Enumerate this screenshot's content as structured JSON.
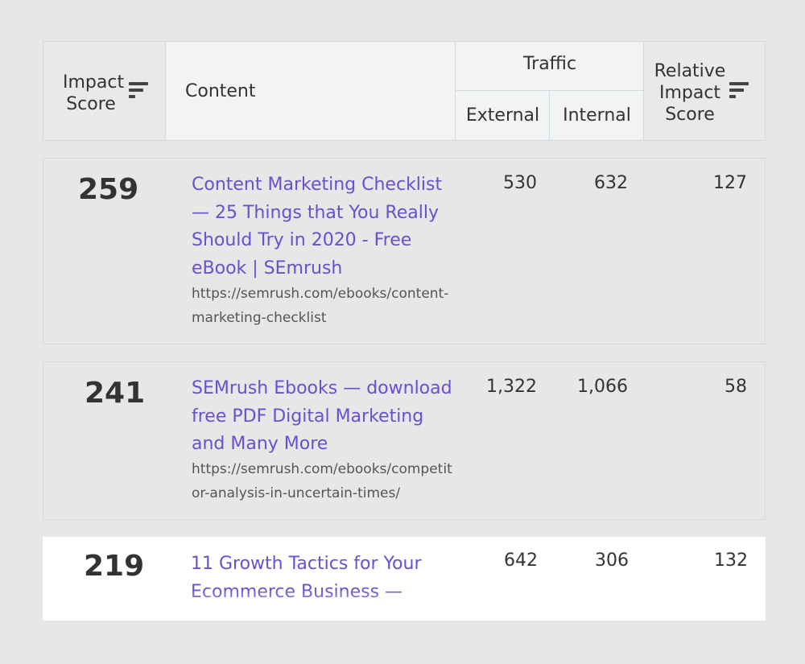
{
  "header": {
    "impact_score_line1": "Impact",
    "impact_score_line2": "Score",
    "content": "Content",
    "traffic": "Traffic",
    "external": "External",
    "internal": "Internal",
    "relative_line1": "Relative",
    "relative_line2": "Impact",
    "relative_line3": "Score"
  },
  "rows": [
    {
      "score": "259",
      "title": "Content Marketing Checklist — 25 Things that You Really Should Try in 2020 - Free eBook | SEmrush",
      "url": "https://semrush.com/ebooks/content-marketing-checklist",
      "external": "530",
      "internal": "632",
      "relative": "127"
    },
    {
      "score": "241",
      "title": "SEMrush Ebooks — download free PDF Digital Marketing and Many More",
      "url": "https://semrush.com/ebooks/competitor-analysis-in-uncertain-times/",
      "external": "1,322",
      "internal": "1,066",
      "relative": "58"
    },
    {
      "score": "219",
      "title": "11 Growth Tactics for Your Ecommerce Business —",
      "url": "",
      "external": "642",
      "internal": "306",
      "relative": "132"
    }
  ]
}
